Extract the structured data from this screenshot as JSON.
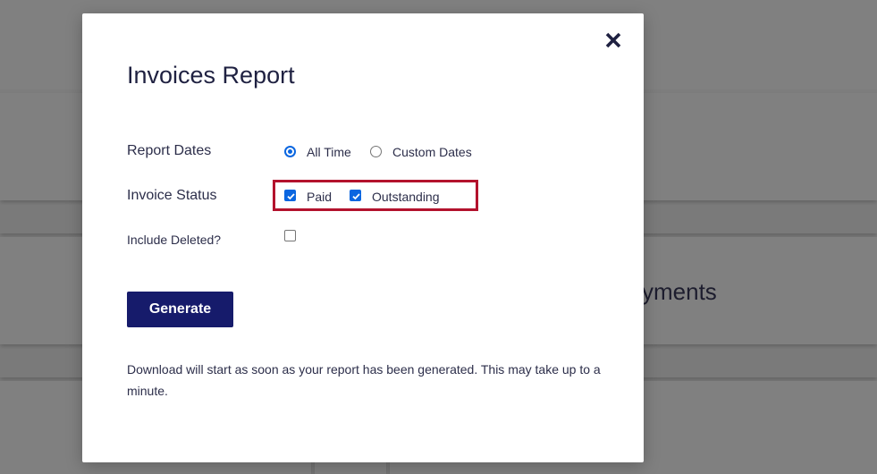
{
  "background": {
    "card_fragment_text": "yments"
  },
  "modal": {
    "title": "Invoices Report",
    "close_icon": "close-icon",
    "report_dates": {
      "label": "Report Dates",
      "options": [
        {
          "label": "All Time",
          "selected": true
        },
        {
          "label": "Custom Dates",
          "selected": false
        }
      ]
    },
    "invoice_status": {
      "label": "Invoice Status",
      "options": [
        {
          "label": "Paid",
          "checked": true
        },
        {
          "label": "Outstanding",
          "checked": true
        }
      ]
    },
    "include_deleted": {
      "label": "Include Deleted?",
      "checked": false
    },
    "generate_label": "Generate",
    "note": "Download will start as soon as your report has been generated. This may take up to a minute."
  },
  "colors": {
    "accent": "#0a66e0",
    "button": "#161b6b",
    "highlight": "#b3122d",
    "overlay": "#7d7d7d"
  }
}
